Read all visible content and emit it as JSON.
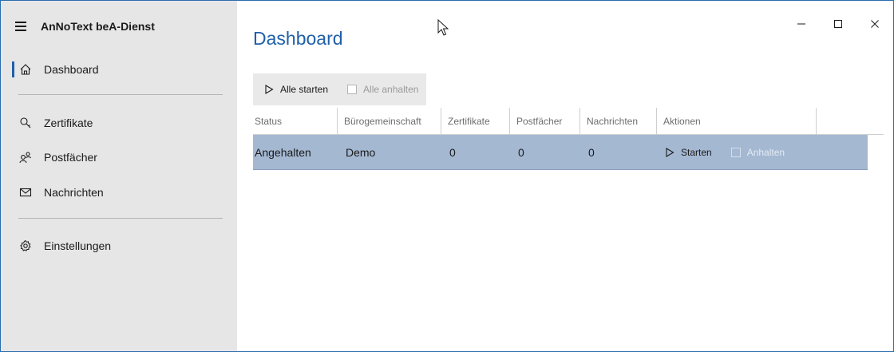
{
  "app": {
    "title": "AnNoText beA-Dienst"
  },
  "sidebar": {
    "items": [
      {
        "label": "Dashboard",
        "icon": "home-icon",
        "active": true
      },
      {
        "label": "Zertifikate",
        "icon": "certificate-icon"
      },
      {
        "label": "Postfächer",
        "icon": "people-icon"
      },
      {
        "label": "Nachrichten",
        "icon": "mail-icon"
      },
      {
        "label": "Einstellungen",
        "icon": "gear-icon"
      }
    ]
  },
  "main": {
    "title": "Dashboard",
    "toolbar": {
      "start_all": "Alle starten",
      "stop_all": "Alle anhalten"
    },
    "table": {
      "columns": [
        "Status",
        "Bürogemeinschaft",
        "Zertifikate",
        "Postfächer",
        "Nachrichten",
        "Aktionen"
      ],
      "rows": [
        {
          "status": "Angehalten",
          "office": "Demo",
          "certificates": "0",
          "mailboxes": "0",
          "messages": "0",
          "start_label": "Starten",
          "stop_label": "Anhalten"
        }
      ]
    }
  },
  "colors": {
    "accent": "#1f5fa8",
    "sidebar_bg": "#e6e6e6",
    "selected_row": "#a4b8d2"
  }
}
